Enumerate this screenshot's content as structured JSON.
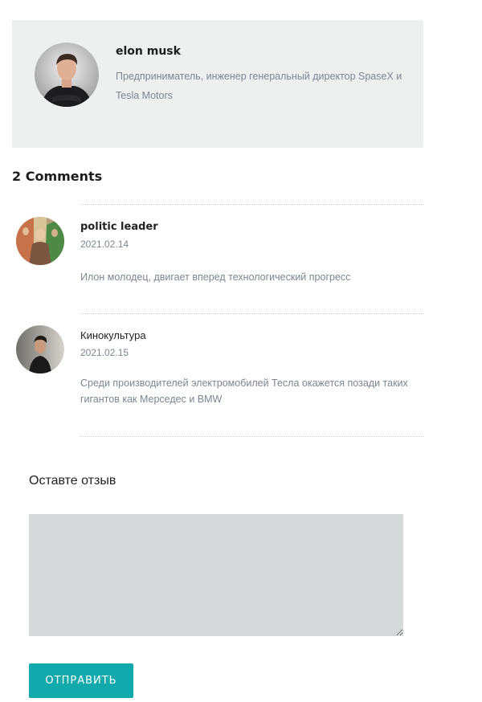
{
  "author": {
    "name": "elon musk",
    "bio": "Предприниматель, инженер генеральный директор SpaseX и Tesla Motors"
  },
  "comments_section": {
    "title": "2 Comments",
    "comments": [
      {
        "author": "politic leader",
        "date": "2021.02.14",
        "text": "Илон молодец, двигает вперед технологический прогресс"
      },
      {
        "author": "Кинокультура",
        "date": "2021.02.15",
        "text": "Среди производителей электромобилей Тесла окажется позади таких гигантов как Мерседес и BMW"
      }
    ]
  },
  "reply": {
    "title": "Оставте отзыв",
    "textarea_value": "",
    "submit_label": "ОТПРАВИТЬ"
  }
}
